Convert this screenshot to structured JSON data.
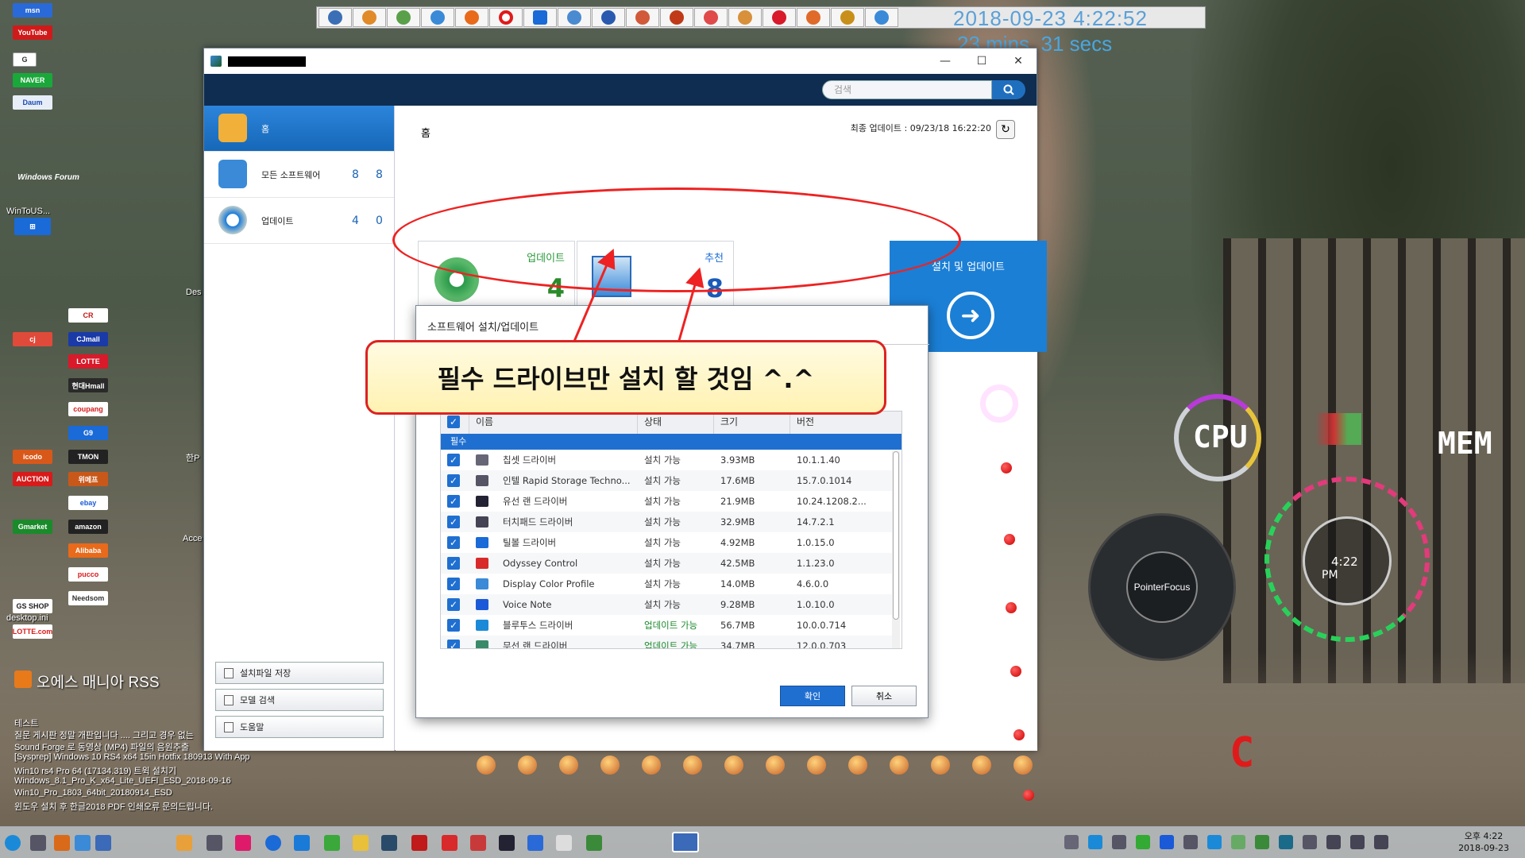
{
  "launcher": {
    "clock": "2018-09-23 4:22:52",
    "uptime": "23 mins, 31 secs"
  },
  "desktop": {
    "left_labels": [
      "msn",
      "YouTube",
      "NAVER",
      "WinToUS...",
      "Windows Forum"
    ],
    "shop_labels": [
      "CJmall",
      "현대Hmall",
      "coupang",
      "TMON",
      "ebay",
      "amazon",
      "icodo",
      "AUCTION",
      "Gmarket",
      "Needsom",
      "GS SHOP",
      "LOTTE.com"
    ],
    "file_labels": [
      "desktop.ini",
      "Des",
      "Acce",
      "한P"
    ],
    "rss_title": "오에스 매니아 RSS",
    "rss_lines": [
      "테스트",
      "질문 게시판 정말 개판입니다 .... 그리고 경우 없는",
      "Sound Forge 로 동영상 (MP4) 파일의 음원추출",
      "[Sysprep] Windows 10 RS4 x64 15in Hotfix 180913 With App",
      "Win10 rs4 Pro 64 (17134.319) 트윅 설치기",
      "Windows_8.1_Pro_K_x64_Lite_UEFI_ESD_2018-09-16",
      "Win10_Pro_1803_64bit_20180914_ESD",
      "윈도우 설치 후 한글2018 PDF 인쇄오류 문의드립니다."
    ]
  },
  "window": {
    "controls": {
      "minimize": "—",
      "maximize": "☐",
      "close": "✕"
    },
    "search_placeholder": "검색",
    "sidebar": [
      {
        "label": "홈"
      },
      {
        "label": "모든 소프트웨어",
        "n1": "8",
        "n2": "8"
      },
      {
        "label": "업데이트",
        "n1": "4",
        "n2": "0"
      }
    ],
    "sidebar_buttons": [
      "설치파일 저장",
      "모델 검색",
      "도움말"
    ],
    "breadcrumb": "홈",
    "last_update": "최종 업데이트 : 09/23/18 16:22:20",
    "tiles": {
      "update": {
        "label": "업데이트",
        "count": "4"
      },
      "recommend": {
        "label": "추천",
        "count": "8"
      },
      "install": {
        "label": "설치 및 업데이트"
      }
    }
  },
  "dialog": {
    "title": "소프트웨어 설치/업데이트",
    "columns": [
      "이름",
      "상태",
      "크기",
      "버전"
    ],
    "group": "필수",
    "rows": [
      {
        "name": "칩셋 드라이버",
        "status": "설치 가능",
        "size": "3.93MB",
        "version": "10.1.1.40"
      },
      {
        "name": "인텔 Rapid Storage Techno...",
        "status": "설치 가능",
        "size": "17.6MB",
        "version": "15.7.0.1014"
      },
      {
        "name": "유선 랜 드라이버",
        "status": "설치 가능",
        "size": "21.9MB",
        "version": "10.24.1208.2..."
      },
      {
        "name": "터치패드 드라이버",
        "status": "설치 가능",
        "size": "32.9MB",
        "version": "14.7.2.1"
      },
      {
        "name": "틸볼 드라이버",
        "status": "설치 가능",
        "size": "4.92MB",
        "version": "1.0.15.0"
      },
      {
        "name": "Odyssey Control",
        "status": "설치 가능",
        "size": "42.5MB",
        "version": "1.1.23.0"
      },
      {
        "name": "Display Color Profile",
        "status": "설치 가능",
        "size": "14.0MB",
        "version": "4.6.0.0"
      },
      {
        "name": "Voice Note",
        "status": "설치 가능",
        "size": "9.28MB",
        "version": "1.0.10.0"
      },
      {
        "name": "블루투스 드라이버",
        "status": "업데이트 가능",
        "size": "56.7MB",
        "version": "10.0.0.714"
      },
      {
        "name": "무선 랜 드라이버",
        "status": "업데이트 가능",
        "size": "34.7MB",
        "version": "12.0.0.703"
      }
    ],
    "ok": "확인",
    "cancel": "취소"
  },
  "annotation": {
    "callout": "필수 드라이브만 설치 할 것임 ^.^"
  },
  "widgets": {
    "cpu": "CPU",
    "mem": "MEM",
    "pointer_focus": "PointerFocus",
    "clock_time": "4:22",
    "clock_ampm": "PM",
    "red_letter": "C"
  },
  "taskbar": {
    "time": "오후 4:22",
    "date": "2018-09-23"
  }
}
